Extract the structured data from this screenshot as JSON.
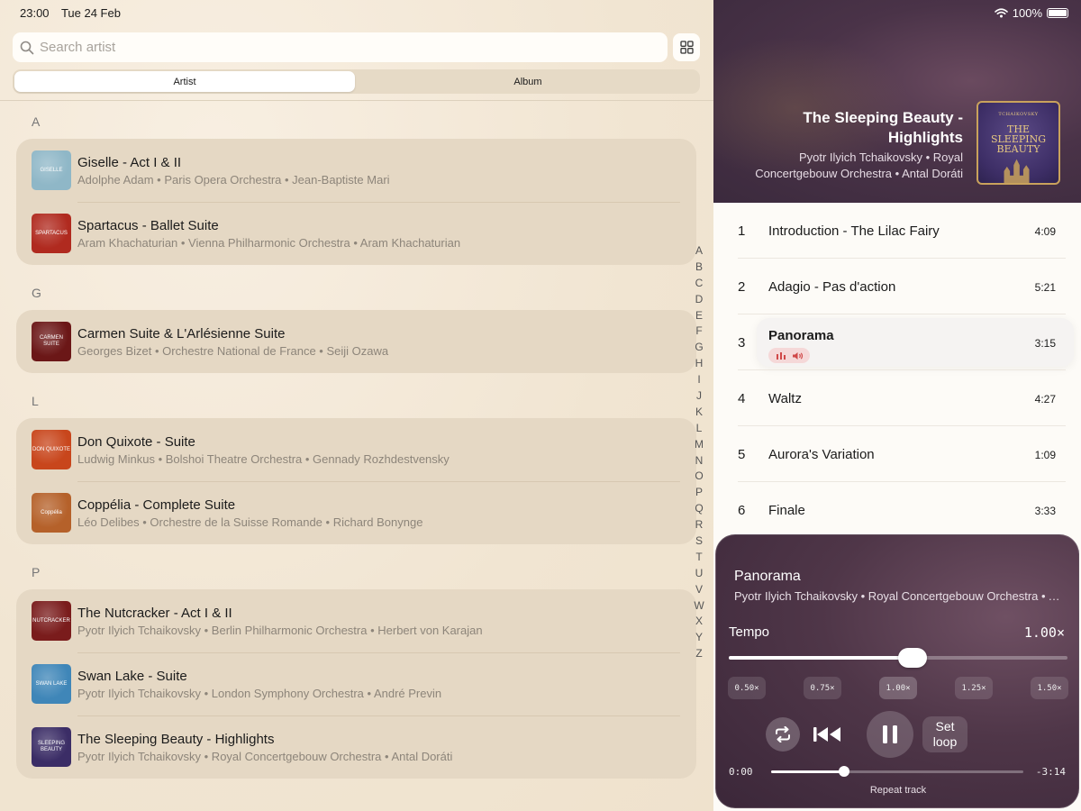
{
  "status": {
    "time": "23:00",
    "date": "Tue 24 Feb",
    "battery": "100%"
  },
  "search": {
    "placeholder": "Search artist"
  },
  "segments": {
    "artist": "Artist",
    "album": "Album"
  },
  "sections": [
    {
      "letter": "A",
      "items": [
        {
          "title": "Giselle - Act I & II",
          "subtitle": "Adolphe Adam • Paris Opera Orchestra • Jean-Baptiste Mari",
          "art": "GISELLE",
          "art_color": "#8fb7c7"
        },
        {
          "title": "Spartacus - Ballet Suite",
          "subtitle": "Aram Khachaturian • Vienna Philharmonic Orchestra • Aram Khachaturian",
          "art": "SPARTACUS",
          "art_color": "#b02a1f"
        }
      ]
    },
    {
      "letter": "G",
      "items": [
        {
          "title": "Carmen Suite & L'Arlésienne Suite",
          "subtitle": "Georges Bizet • Orchestre National de France • Seiji Ozawa",
          "art": "CARMEN SUITE",
          "art_color": "#6b1717"
        }
      ]
    },
    {
      "letter": "L",
      "items": [
        {
          "title": "Don Quixote - Suite",
          "subtitle": "Ludwig Minkus • Bolshoi Theatre Orchestra • Gennady Rozhdestvensky",
          "art": "DON QUIXOTE",
          "art_color": "#c8461c"
        },
        {
          "title": "Coppélia - Complete Suite",
          "subtitle": "Léo Delibes • Orchestre de la Suisse Romande • Richard Bonynge",
          "art": "Coppélia",
          "art_color": "#b5612a"
        }
      ]
    },
    {
      "letter": "P",
      "items": [
        {
          "title": "The Nutcracker - Act I & II",
          "subtitle": "Pyotr Ilyich Tchaikovsky • Berlin Philharmonic Orchestra • Herbert von Karajan",
          "art": "NUTCRACKER",
          "art_color": "#7a1c1c"
        },
        {
          "title": "Swan Lake - Suite",
          "subtitle": "Pyotr Ilyich Tchaikovsky • London Symphony Orchestra • André Previn",
          "art": "SWAN LAKE",
          "art_color": "#3f86b8"
        },
        {
          "title": "The Sleeping Beauty - Highlights",
          "subtitle": "Pyotr Ilyich Tchaikovsky • Royal Concertgebouw Orchestra • Antal Doráti",
          "art": "SLEEPING BEAUTY",
          "art_color": "#3b2d66"
        }
      ]
    }
  ],
  "index_letters": [
    "A",
    "B",
    "C",
    "D",
    "E",
    "F",
    "G",
    "H",
    "I",
    "J",
    "K",
    "L",
    "M",
    "N",
    "O",
    "P",
    "Q",
    "R",
    "S",
    "T",
    "U",
    "V",
    "W",
    "X",
    "Y",
    "Z"
  ],
  "album": {
    "title": "The Sleeping Beauty - Highlights",
    "subtitle": "Pyotr Ilyich Tchaikovsky • Royal Concertgebouw Orchestra • Antal Doráti",
    "art_lines": [
      "TCHAIKOVSKY",
      "THE",
      "SLEEPING",
      "BEAUTY"
    ],
    "tracks": [
      {
        "num": "1",
        "name": "Introduction - The Lilac Fairy",
        "duration": "4:09"
      },
      {
        "num": "2",
        "name": "Adagio - Pas d'action",
        "duration": "5:21"
      },
      {
        "num": "3",
        "name": "Panorama",
        "duration": "3:15",
        "playing": true
      },
      {
        "num": "4",
        "name": "Waltz",
        "duration": "4:27"
      },
      {
        "num": "5",
        "name": "Aurora's Variation",
        "duration": "1:09"
      },
      {
        "num": "6",
        "name": "Finale",
        "duration": "3:33"
      }
    ]
  },
  "player": {
    "title": "Panorama",
    "subtitle": "Pyotr Ilyich Tchaikovsky • Royal Concertgebouw Orchestra • Antal Doráti",
    "tempo_label": "Tempo",
    "tempo_value": "1.00×",
    "tempo_fraction": 0.5,
    "presets": [
      "0.50×",
      "0.75×",
      "1.00×",
      "1.25×",
      "1.50×"
    ],
    "active_preset": 2,
    "loop_label_1": "Set",
    "loop_label_2": "loop",
    "time_current": "0:00",
    "time_remaining": "-3:14",
    "progress_fraction": 0.29,
    "repeat_label": "Repeat track"
  }
}
